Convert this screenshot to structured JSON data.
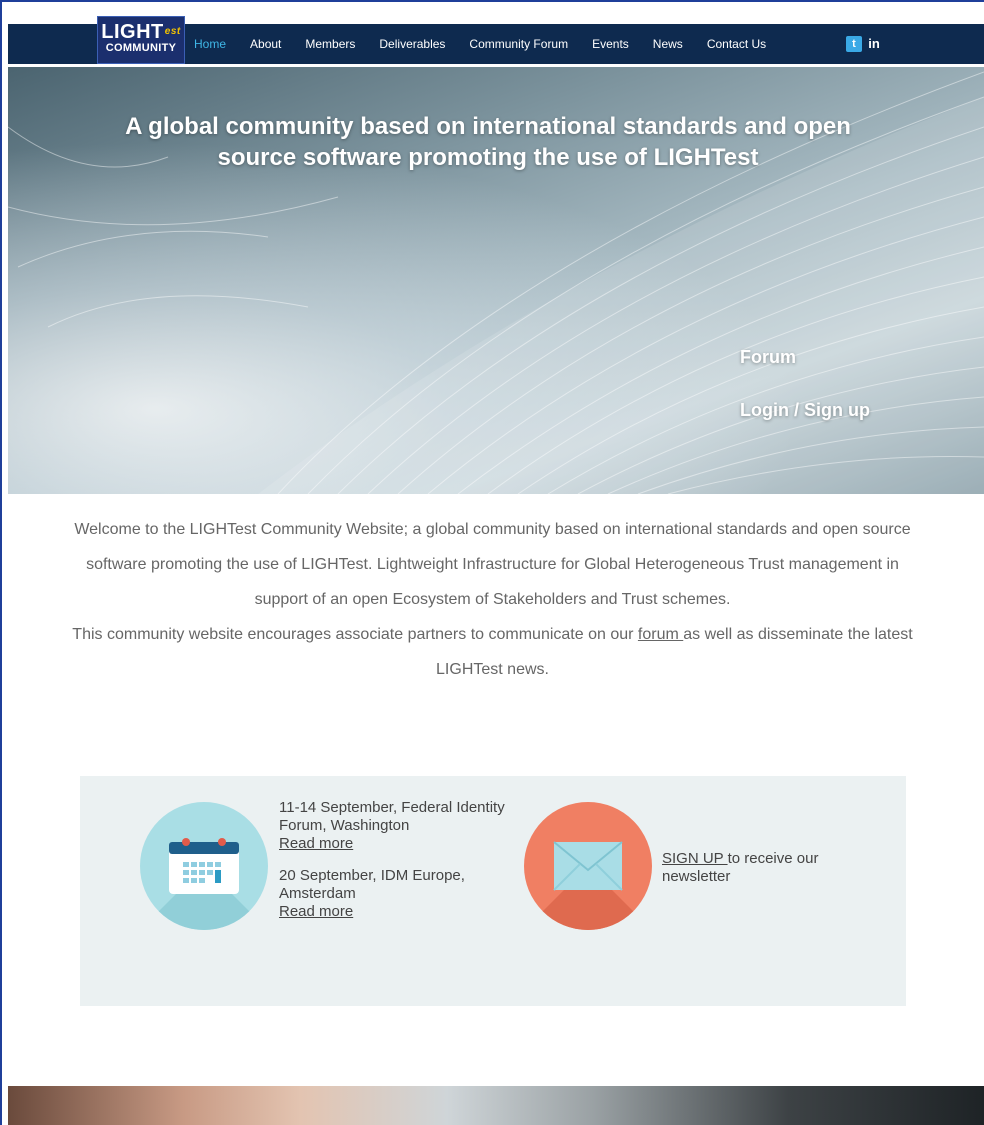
{
  "nav": {
    "logo_top": "LIGHT",
    "logo_sup": "est",
    "logo_bottom": "COMMUNITY",
    "items": [
      "Home",
      "About",
      "Members",
      "Deliverables",
      "Community Forum",
      "Events",
      "News",
      "Contact Us"
    ],
    "active": "Home",
    "social": [
      {
        "icon": "twitter-icon",
        "glyph": "t",
        "color": "#3aa9e6"
      },
      {
        "icon": "linkedin-icon",
        "glyph": "in",
        "color": "#0e2a4f"
      }
    ]
  },
  "hero": {
    "title": "A global community based on international standards and open source software promoting the use of LIGHTest",
    "forum_link": "Forum",
    "login_link": "Login / Sign up"
  },
  "welcome": {
    "p1": "Welcome to the LIGHTest Community Website; a global community based on international standards and open source software promoting the use of LIGHTest. Lightweight Infrastructure for Global Heterogeneous Trust management in support of an open Ecosystem of Stakeholders and Trust schemes.",
    "p2_before": "This community website encourages associate partners to communicate on our ",
    "p2_link": "forum ",
    "p2_after": "as well as disseminate the latest LIGHTest news."
  },
  "info": {
    "events": [
      {
        "text": "11-14 September, Federal Identity Forum, Washington",
        "link": "Read more"
      },
      {
        "text": "20 September, IDM Europe, Amsterdam",
        "link": "Read more"
      }
    ],
    "signup_link": "SIGN UP ",
    "signup_text": "to receive our newsletter",
    "calendar_icon": "calendar-icon",
    "mail_icon": "envelope-icon",
    "colors": {
      "calendar_circle": "#a9dee5",
      "mail_circle": "#f07f63",
      "box_bg": "#ebf1f2"
    }
  }
}
